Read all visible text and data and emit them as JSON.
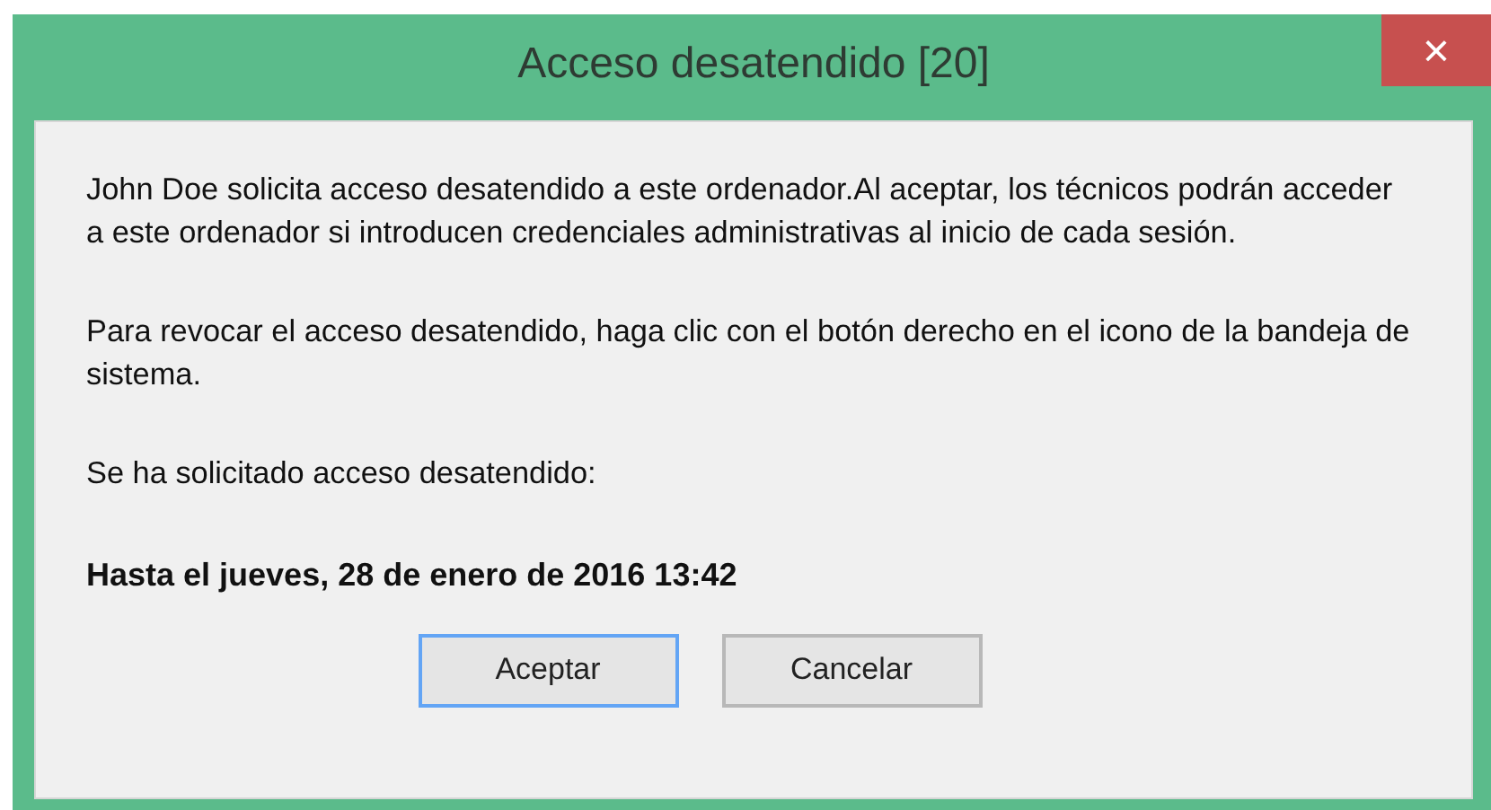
{
  "window": {
    "title": "Acceso desatendido [20]",
    "close": "×"
  },
  "paragraphs": [
    "John Doe solicita acceso desatendido a este ordenador.Al aceptar, los técnicos podrán acceder a este ordenador si introducen credenciales administrativas al inicio de cada sesión.",
    "Para revocar el acceso desatendido, haga clic con el botón derecho en el icono de la bandeja de sistema.",
    "Se ha solicitado acceso desatendido:"
  ],
  "deadline": "Hasta el jueves, 28 de enero de 2016 13:42",
  "buttons": [
    {
      "label": "Aceptar",
      "default": true
    },
    {
      "label": "Cancelar",
      "default": false
    }
  ]
}
